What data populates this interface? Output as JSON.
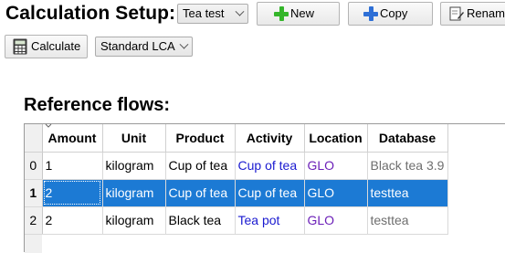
{
  "setup": {
    "title": "Calculation Setup:",
    "setup_select": "Tea test",
    "new_label": "New",
    "copy_label": "Copy",
    "rename_label": "Renam",
    "calculate_label": "Calculate",
    "method_select": "Standard LCA"
  },
  "reference": {
    "heading": "Reference flows:",
    "columns": [
      "Amount",
      "Unit",
      "Product",
      "Activity",
      "Location",
      "Database"
    ],
    "rows": [
      {
        "index": "0",
        "amount": "1",
        "unit": "kilogram",
        "product": "Cup of tea",
        "activity": "Cup of tea",
        "location": "GLO",
        "database": "Black tea 3.9"
      },
      {
        "index": "1",
        "amount": "2",
        "unit": "kilogram",
        "product": "Cup of tea",
        "activity": "Cup of tea",
        "location": "GLO",
        "database": "testtea"
      },
      {
        "index": "2",
        "amount": "2",
        "unit": "kilogram",
        "product": "Black tea",
        "activity": "Tea pot",
        "location": "GLO",
        "database": "testtea"
      }
    ],
    "selected_row": "1"
  },
  "icons": {
    "new": "plus-green-icon",
    "copy": "plus-blue-icon",
    "rename": "rename-pencil-icon",
    "calculate": "calculator-icon"
  },
  "colors": {
    "selection": "#1c7ad4",
    "link": "#1a1ad0",
    "location": "#6b1fb8"
  }
}
